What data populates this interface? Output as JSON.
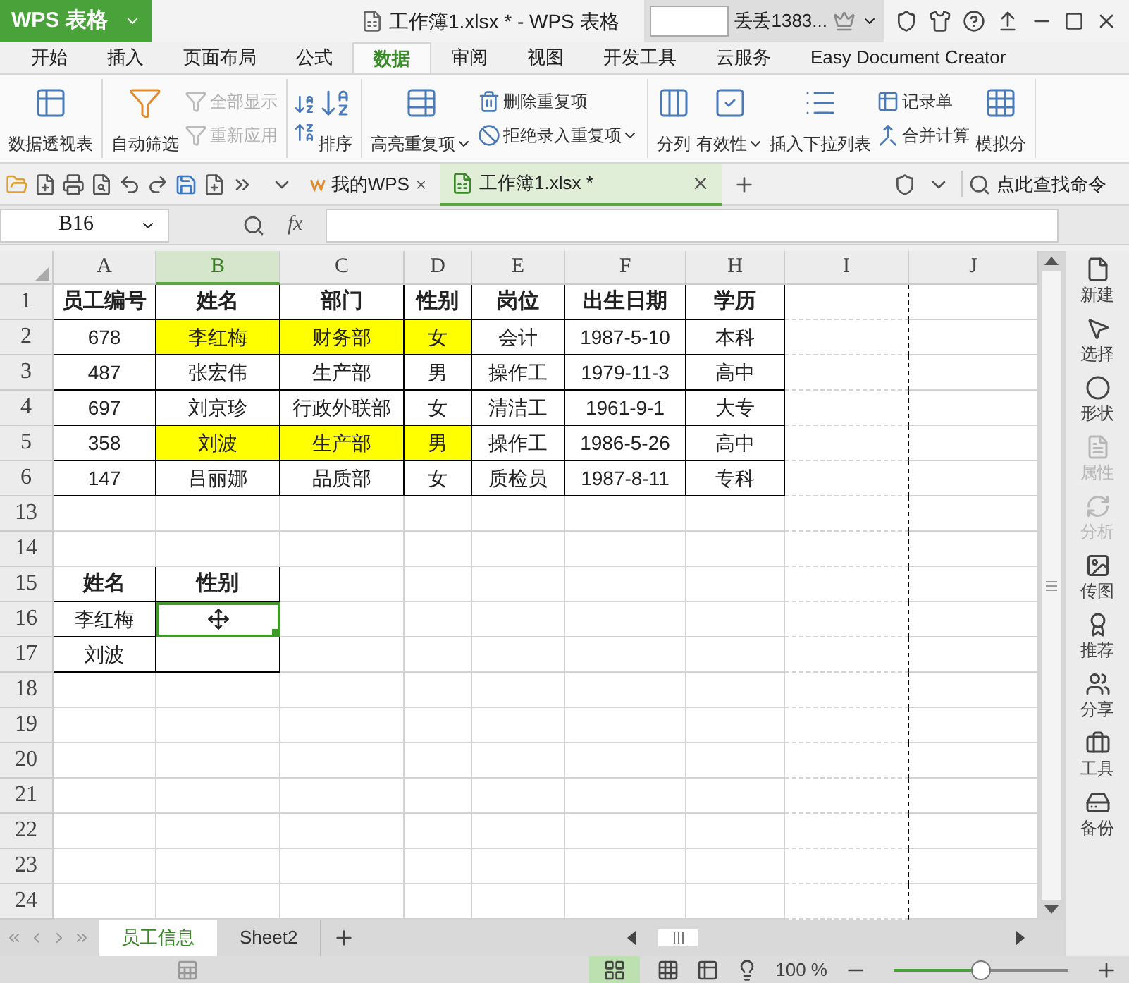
{
  "title_bar": {
    "app_button": "WPS 表格",
    "title": "工作簿1.xlsx * - WPS 表格",
    "user": "丢丢1383..."
  },
  "menu_tabs": [
    {
      "label": "开始",
      "selected": false
    },
    {
      "label": "插入",
      "selected": false
    },
    {
      "label": "页面布局",
      "selected": false
    },
    {
      "label": "公式",
      "selected": false
    },
    {
      "label": "数据",
      "selected": true
    },
    {
      "label": "审阅",
      "selected": false
    },
    {
      "label": "视图",
      "selected": false
    },
    {
      "label": "开发工具",
      "selected": false
    },
    {
      "label": "云服务",
      "selected": false
    },
    {
      "label": "Easy Document Creator",
      "selected": false
    }
  ],
  "ribbon": [
    {
      "items": [
        {
          "kind": "large",
          "label": "数据透视表",
          "dropdown": false,
          "disabled": false
        }
      ]
    },
    {
      "items": [
        {
          "kind": "large",
          "label": "自动筛选",
          "dropdown": false,
          "disabled": false
        },
        {
          "kind": "small",
          "label": "全部显示",
          "dropdown": false,
          "disabled": true
        },
        {
          "kind": "small",
          "label": "重新应用",
          "dropdown": false,
          "disabled": true
        }
      ]
    },
    {
      "items": [
        {
          "kind": "large",
          "label": "排序",
          "dropdown": false,
          "disabled": false
        }
      ]
    },
    {
      "items": [
        {
          "kind": "large",
          "label": "高亮重复项",
          "dropdown": true,
          "disabled": false
        },
        {
          "kind": "small",
          "label": "删除重复项",
          "dropdown": false,
          "disabled": false
        },
        {
          "kind": "small",
          "label": "拒绝录入重复项",
          "dropdown": true,
          "disabled": false
        }
      ]
    },
    {
      "items": [
        {
          "kind": "large",
          "label": "分列",
          "dropdown": false,
          "disabled": false
        },
        {
          "kind": "large",
          "label": "有效性",
          "dropdown": true,
          "disabled": false
        },
        {
          "kind": "large",
          "label": "插入下拉列表",
          "dropdown": false,
          "disabled": false
        },
        {
          "kind": "small",
          "label": "记录单",
          "dropdown": false,
          "disabled": false
        },
        {
          "kind": "small",
          "label": "合并计算",
          "dropdown": false,
          "disabled": false
        },
        {
          "kind": "large",
          "label": "模拟分",
          "dropdown": false,
          "disabled": false
        }
      ]
    }
  ],
  "doc_tabs": [
    {
      "label": "我的WPS",
      "selected": false
    },
    {
      "label": "工作簿1.xlsx *",
      "selected": true
    }
  ],
  "command_search": {
    "placeholder": "点此查找命令"
  },
  "formula_bar": {
    "name_box": "B16",
    "fx": "fx"
  },
  "columns": [
    {
      "label": "A",
      "selected": false
    },
    {
      "label": "B",
      "selected": true
    },
    {
      "label": "C",
      "selected": false
    },
    {
      "label": "D",
      "selected": false
    },
    {
      "label": "E",
      "selected": false
    },
    {
      "label": "F",
      "selected": false
    },
    {
      "label": "H",
      "selected": false
    },
    {
      "label": "I",
      "selected": false
    },
    {
      "label": "J",
      "selected": false
    }
  ],
  "rows": [
    {
      "label": "1",
      "cells": [
        {
          "text": "员工编号",
          "bold": true,
          "highlighted": false
        },
        {
          "text": "姓名",
          "bold": true,
          "highlighted": false
        },
        {
          "text": "部门",
          "bold": true,
          "highlighted": false
        },
        {
          "text": "性别",
          "bold": true,
          "highlighted": false
        },
        {
          "text": "岗位",
          "bold": true,
          "highlighted": false
        },
        {
          "text": "出生日期",
          "bold": true,
          "highlighted": false
        },
        {
          "text": "学历",
          "bold": true,
          "highlighted": false
        }
      ]
    },
    {
      "label": "2",
      "cells": [
        {
          "text": "678",
          "bold": false,
          "highlighted": false
        },
        {
          "text": "李红梅",
          "bold": false,
          "highlighted": true
        },
        {
          "text": "财务部",
          "bold": false,
          "highlighted": true
        },
        {
          "text": "女",
          "bold": false,
          "highlighted": true
        },
        {
          "text": "会计",
          "bold": false,
          "highlighted": false
        },
        {
          "text": "1987-5-10",
          "bold": false,
          "highlighted": false
        },
        {
          "text": "本科",
          "bold": false,
          "highlighted": false
        }
      ]
    },
    {
      "label": "3",
      "cells": [
        {
          "text": "487",
          "bold": false,
          "highlighted": false
        },
        {
          "text": "张宏伟",
          "bold": false,
          "highlighted": false
        },
        {
          "text": "生产部",
          "bold": false,
          "highlighted": false
        },
        {
          "text": "男",
          "bold": false,
          "highlighted": false
        },
        {
          "text": "操作工",
          "bold": false,
          "highlighted": false
        },
        {
          "text": "1979-11-3",
          "bold": false,
          "highlighted": false
        },
        {
          "text": "高中",
          "bold": false,
          "highlighted": false
        }
      ]
    },
    {
      "label": "4",
      "cells": [
        {
          "text": "697",
          "bold": false,
          "highlighted": false
        },
        {
          "text": "刘京珍",
          "bold": false,
          "highlighted": false
        },
        {
          "text": "行政外联部",
          "bold": false,
          "highlighted": false
        },
        {
          "text": "女",
          "bold": false,
          "highlighted": false
        },
        {
          "text": "清洁工",
          "bold": false,
          "highlighted": false
        },
        {
          "text": "1961-9-1",
          "bold": false,
          "highlighted": false
        },
        {
          "text": "大专",
          "bold": false,
          "highlighted": false
        }
      ]
    },
    {
      "label": "5",
      "cells": [
        {
          "text": "358",
          "bold": false,
          "highlighted": false
        },
        {
          "text": "刘波",
          "bold": false,
          "highlighted": true
        },
        {
          "text": "生产部",
          "bold": false,
          "highlighted": true
        },
        {
          "text": "男",
          "bold": false,
          "highlighted": true
        },
        {
          "text": "操作工",
          "bold": false,
          "highlighted": false
        },
        {
          "text": "1986-5-26",
          "bold": false,
          "highlighted": false
        },
        {
          "text": "高中",
          "bold": false,
          "highlighted": false
        }
      ]
    },
    {
      "label": "6",
      "cells": [
        {
          "text": "147",
          "bold": false,
          "highlighted": false
        },
        {
          "text": "吕丽娜",
          "bold": false,
          "highlighted": false
        },
        {
          "text": "品质部",
          "bold": false,
          "highlighted": false
        },
        {
          "text": "女",
          "bold": false,
          "highlighted": false
        },
        {
          "text": "质检员",
          "bold": false,
          "highlighted": false
        },
        {
          "text": "1987-8-11",
          "bold": false,
          "highlighted": false
        },
        {
          "text": "专科",
          "bold": false,
          "highlighted": false
        }
      ]
    },
    {
      "label": "13"
    },
    {
      "label": "14"
    },
    {
      "label": "15",
      "cells": [
        {
          "text": "姓名",
          "bold": true,
          "highlighted": false
        },
        {
          "text": "性别",
          "bold": true,
          "highlighted": false
        }
      ]
    },
    {
      "label": "16",
      "cells": [
        {
          "text": "李红梅",
          "bold": false,
          "highlighted": false,
          "selected": false
        },
        {
          "selected": true
        }
      ]
    },
    {
      "label": "17",
      "cells": [
        {
          "text": "刘波",
          "bold": false,
          "highlighted": false,
          "selected": false
        },
        {
          "selected": false
        }
      ]
    },
    {
      "label": "18"
    },
    {
      "label": "19"
    },
    {
      "label": "20"
    },
    {
      "label": "21"
    },
    {
      "label": "22"
    },
    {
      "label": "23"
    },
    {
      "label": "24"
    }
  ],
  "side_panel": [
    {
      "label": "新建",
      "disabled": false
    },
    {
      "label": "选择",
      "disabled": false
    },
    {
      "label": "形状",
      "disabled": false
    },
    {
      "label": "属性",
      "disabled": true
    },
    {
      "label": "分析",
      "disabled": true
    },
    {
      "label": "传图",
      "disabled": false
    },
    {
      "label": "推荐",
      "disabled": false
    },
    {
      "label": "分享",
      "disabled": false
    },
    {
      "label": "工具",
      "disabled": false
    },
    {
      "label": "备份",
      "disabled": false
    }
  ],
  "sheet_tabs": [
    {
      "label": "员工信息",
      "selected": true
    },
    {
      "label": "Sheet2",
      "selected": false
    }
  ],
  "status_bar": {
    "zoom": "100 %",
    "level": 0.5
  }
}
